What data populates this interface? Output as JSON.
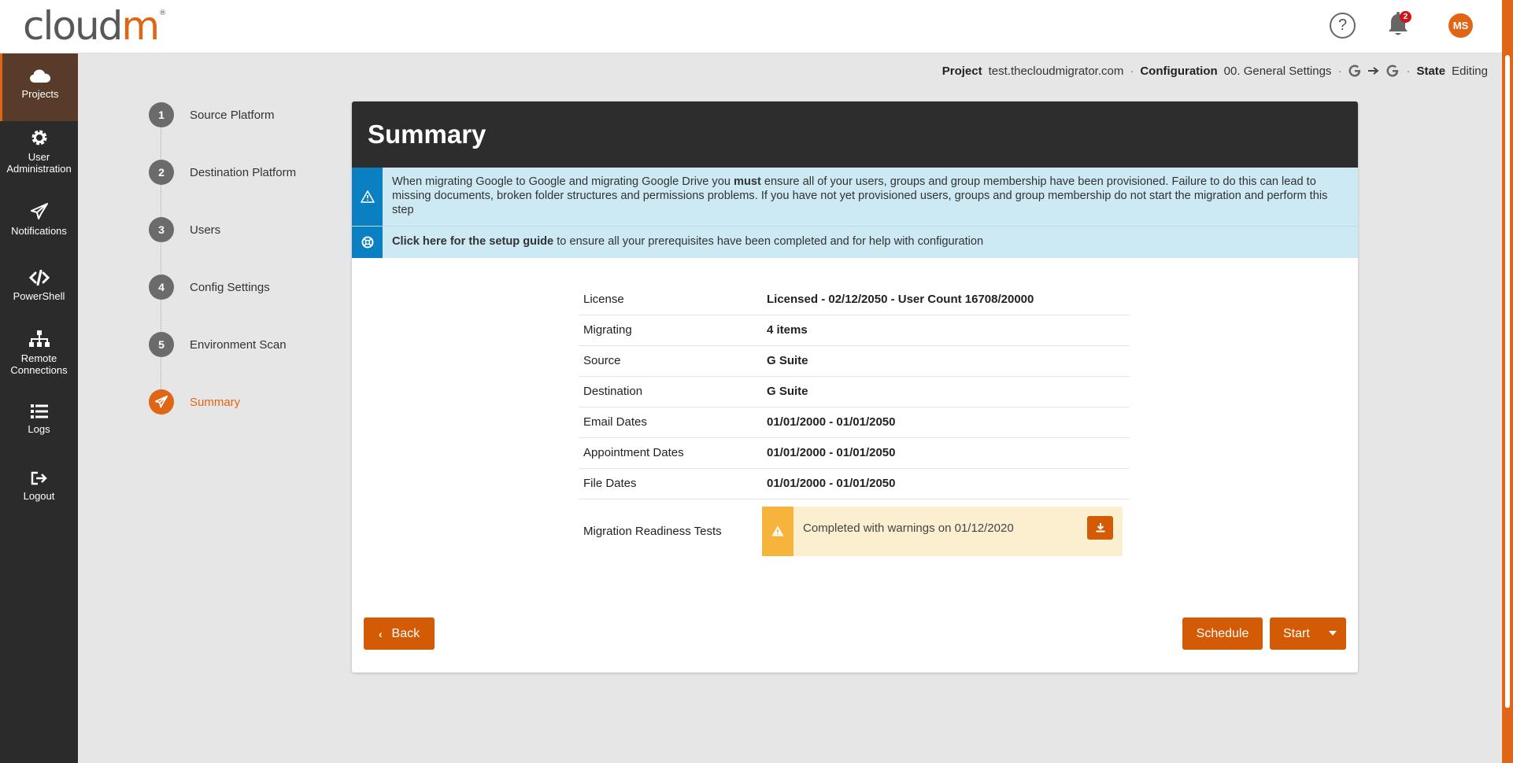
{
  "brand": {
    "logo_part1": "cloud",
    "logo_part2": "m",
    "logo_reg": "®",
    "accent": "#e06514"
  },
  "topbar": {
    "help_icon": "question-circle-icon",
    "notifications_count": "2",
    "user_initials": "MS"
  },
  "sidebar": {
    "items": [
      {
        "label": "Projects",
        "icon": "cloud-icon",
        "active": true
      },
      {
        "label_line1": "User",
        "label_line2": "Administration",
        "icon": "gear-icon"
      },
      {
        "label": "Notifications",
        "icon": "paper-plane-icon"
      },
      {
        "label": "PowerShell",
        "icon": "code-icon"
      },
      {
        "label_line1": "Remote",
        "label_line2": "Connections",
        "icon": "sitemap-icon"
      },
      {
        "label": "Logs",
        "icon": "list-icon"
      },
      {
        "label": "Logout",
        "icon": "sign-out-icon"
      }
    ]
  },
  "breadcrumb": {
    "project_label": "Project",
    "project_value": "test.thecloudmigrator.com",
    "config_label": "Configuration",
    "config_value": "00. General Settings",
    "state_label": "State",
    "state_value": "Editing",
    "separator": "·"
  },
  "steps": [
    {
      "num": "1",
      "label": "Source Platform"
    },
    {
      "num": "2",
      "label": "Destination Platform"
    },
    {
      "num": "3",
      "label": "Users"
    },
    {
      "num": "4",
      "label": "Config Settings"
    },
    {
      "num": "5",
      "label": "Environment Scan"
    },
    {
      "num": "",
      "label": "Summary",
      "current": true
    }
  ],
  "card": {
    "title": "Summary",
    "alert1": {
      "pre": "When migrating Google to Google and migrating Google Drive you ",
      "bold": "must",
      "post": " ensure all of your users, groups and group membership have been provisioned. Failure to do this can lead to missing documents, broken folder structures and permissions problems. If you have not yet provisioned users, groups and group membership do not start the migration and perform this step"
    },
    "alert2": {
      "link": "Click here for the setup guide",
      "post": " to ensure all your prerequisites have been completed and for help with configuration"
    },
    "rows": [
      {
        "key": "License",
        "value": "Licensed - 02/12/2050 - User Count 16708/20000"
      },
      {
        "key": "Migrating",
        "value": "4 items"
      },
      {
        "key": "Source",
        "value": "G Suite"
      },
      {
        "key": "Destination",
        "value": "G Suite"
      },
      {
        "key": "Email Dates",
        "value": "01/01/2000 - 01/01/2050"
      },
      {
        "key": "Appointment Dates",
        "value": "01/01/2000 - 01/01/2050"
      },
      {
        "key": "File Dates",
        "value": "01/01/2000 - 01/01/2050"
      }
    ],
    "readiness": {
      "key": "Migration Readiness Tests",
      "status": "Completed with warnings on 01/12/2020"
    },
    "buttons": {
      "back": "Back",
      "schedule": "Schedule",
      "start": "Start"
    }
  }
}
